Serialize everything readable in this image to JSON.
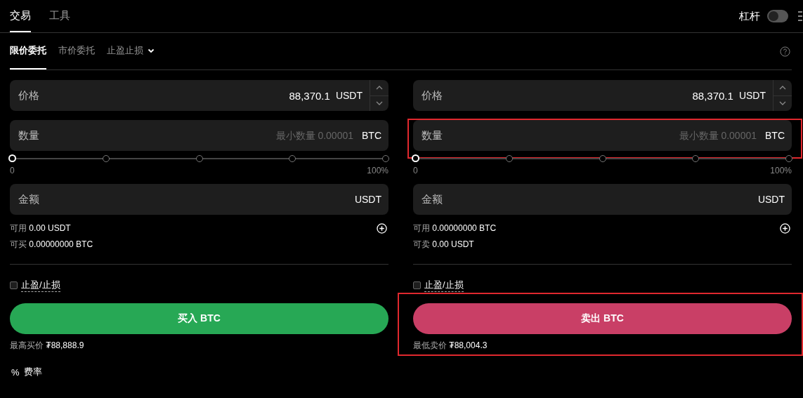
{
  "top_tabs": [
    {
      "label": "交易",
      "selected": true
    },
    {
      "label": "工具",
      "selected": false
    }
  ],
  "leverage": {
    "label": "杠杆",
    "on": false
  },
  "order_tabs": [
    {
      "label": "限价委托",
      "selected": true,
      "kind": "tab"
    },
    {
      "label": "市价委托",
      "selected": false,
      "kind": "tab"
    },
    {
      "label": "止盈止损",
      "selected": false,
      "kind": "dropdown"
    }
  ],
  "panels": [
    {
      "price": {
        "label": "价格",
        "value": "88,370.1",
        "unit": "USDT"
      },
      "quantity": {
        "label": "数量",
        "placeholder": "最小数量 0.00001",
        "unit": "BTC",
        "highlighted": false
      },
      "slider": {
        "level": 0,
        "min_label": "0",
        "max_label": "100%"
      },
      "amount": {
        "label": "金额",
        "unit": "USDT"
      },
      "available": {
        "label": "可用",
        "value": "0.00 USDT"
      },
      "can_trade": {
        "label": "可买",
        "value": "0.00000000 BTC"
      },
      "tpsl": {
        "label": "止盈/止损",
        "checked": false
      },
      "action": {
        "label": "买入 BTC",
        "kind": "buy",
        "highlighted": false
      },
      "best_price": {
        "label": "最高买价",
        "value": "₮88,888.9"
      }
    },
    {
      "price": {
        "label": "价格",
        "value": "88,370.1",
        "unit": "USDT"
      },
      "quantity": {
        "label": "数量",
        "placeholder": "最小数量 0.00001",
        "unit": "BTC",
        "highlighted": true
      },
      "slider": {
        "level": 0,
        "min_label": "0",
        "max_label": "100%"
      },
      "amount": {
        "label": "金额",
        "unit": "USDT"
      },
      "available": {
        "label": "可用",
        "value": "0.00000000 BTC"
      },
      "can_trade": {
        "label": "可卖",
        "value": "0.00 USDT"
      },
      "tpsl": {
        "label": "止盈/止损",
        "checked": false
      },
      "action": {
        "label": "卖出 BTC",
        "kind": "sell",
        "highlighted": true
      },
      "best_price": {
        "label": "最低卖价",
        "value": "₮88,004.3"
      }
    }
  ],
  "fee": {
    "icon": "%",
    "label": "费率"
  }
}
